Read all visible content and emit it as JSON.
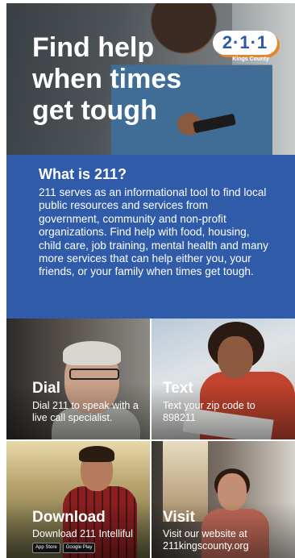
{
  "hero": {
    "headline": "Find help when times get tough",
    "logo_number": "2·1·1",
    "logo_subtitle": "Kings County"
  },
  "info": {
    "heading": "What is 211?",
    "body": "211 serves as an informational tool to find local public resources and services from government, community and non-profit organizations. Find help with food, housing, child care, job training, mental health and many more services that can help either you, your friends, or your family when times get tough."
  },
  "tiles": [
    {
      "title": "Dial",
      "text": "Dial 211 to speak with a live call specialist."
    },
    {
      "title": "Text",
      "text": "Text your zip code to 898211"
    },
    {
      "title": "Download",
      "text": "Download 211 Intelliful"
    },
    {
      "title": "Visit",
      "text": "Visit our website at 211kingscounty.org"
    }
  ],
  "store_badges": [
    "App Store",
    "Google Play"
  ],
  "colors": {
    "brand_blue": "#2f5ba9",
    "logo_orange": "#e8842a"
  }
}
